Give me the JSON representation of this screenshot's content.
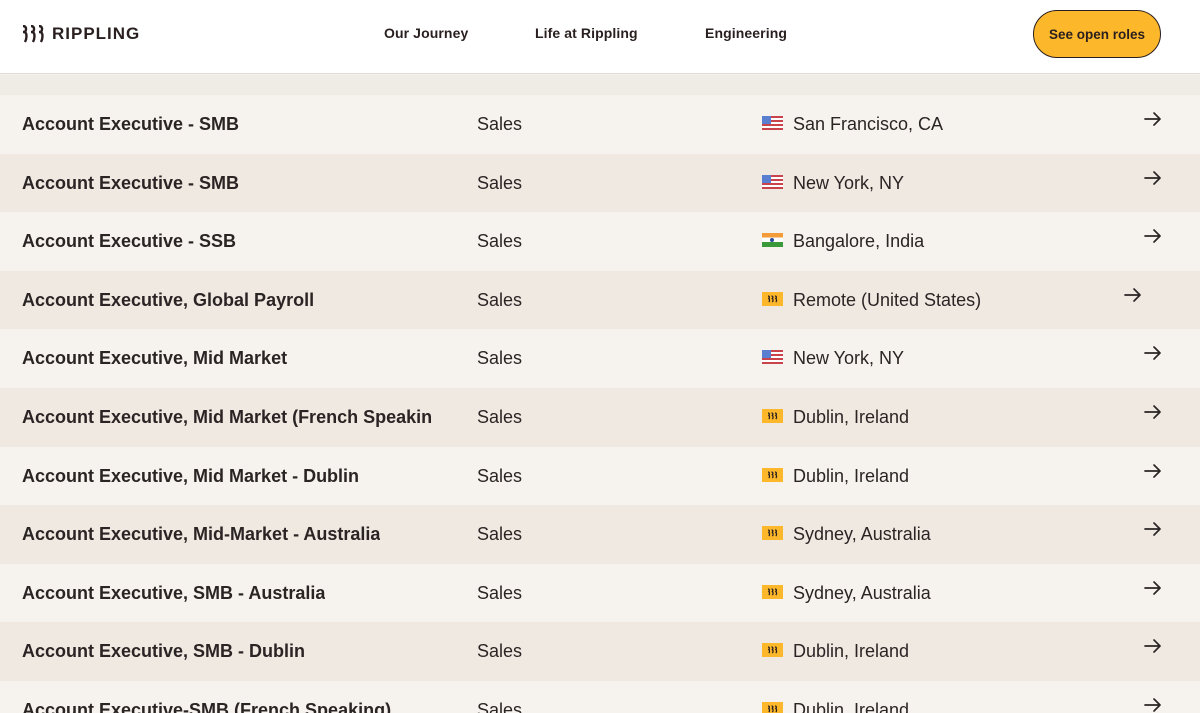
{
  "header": {
    "logo_text": "RIPPLING",
    "nav": [
      "Our Journey",
      "Life at Rippling",
      "Engineering"
    ],
    "cta": "See open roles"
  },
  "jobs": [
    {
      "title": "Account Executive - SMB",
      "department": "Sales",
      "location": "San Francisco, CA",
      "flag": "us-flag-icon"
    },
    {
      "title": "Account Executive - SMB",
      "department": "Sales",
      "location": "New York, NY",
      "flag": "us-flag-icon"
    },
    {
      "title": "Account Executive - SSB",
      "department": "Sales",
      "location": "Bangalore, India",
      "flag": "india-flag-icon"
    },
    {
      "title": "Account Executive, Global Payroll",
      "department": "Sales",
      "location": "Remote (United States)",
      "flag": "rippling-logo-icon"
    },
    {
      "title": "Account Executive, Mid Market",
      "department": "Sales",
      "location": "New York, NY",
      "flag": "us-flag-icon"
    },
    {
      "title": "Account Executive, Mid Market (French Speaking)",
      "department": "Sales",
      "location": "Dublin, Ireland",
      "flag": "rippling-logo-icon"
    },
    {
      "title": "Account Executive, Mid Market - Dublin",
      "department": "Sales",
      "location": "Dublin, Ireland",
      "flag": "rippling-logo-icon"
    },
    {
      "title": "Account Executive, Mid-Market - Australia",
      "department": "Sales",
      "location": "Sydney, Australia",
      "flag": "rippling-logo-icon"
    },
    {
      "title": "Account Executive, SMB - Australia",
      "department": "Sales",
      "location": "Sydney, Australia",
      "flag": "rippling-logo-icon"
    },
    {
      "title": "Account Executive, SMB - Dublin",
      "department": "Sales",
      "location": "Dublin, Ireland",
      "flag": "rippling-logo-icon"
    },
    {
      "title": "Account Executive-SMB (French Speaking)",
      "department": "Sales",
      "location": "Dublin, Ireland",
      "flag": "rippling-logo-icon"
    }
  ],
  "colors": {
    "accent": "#fdb72a",
    "text": "#2b2424",
    "row_light": "#f6f3ee",
    "row_dark": "#efe9e2"
  }
}
